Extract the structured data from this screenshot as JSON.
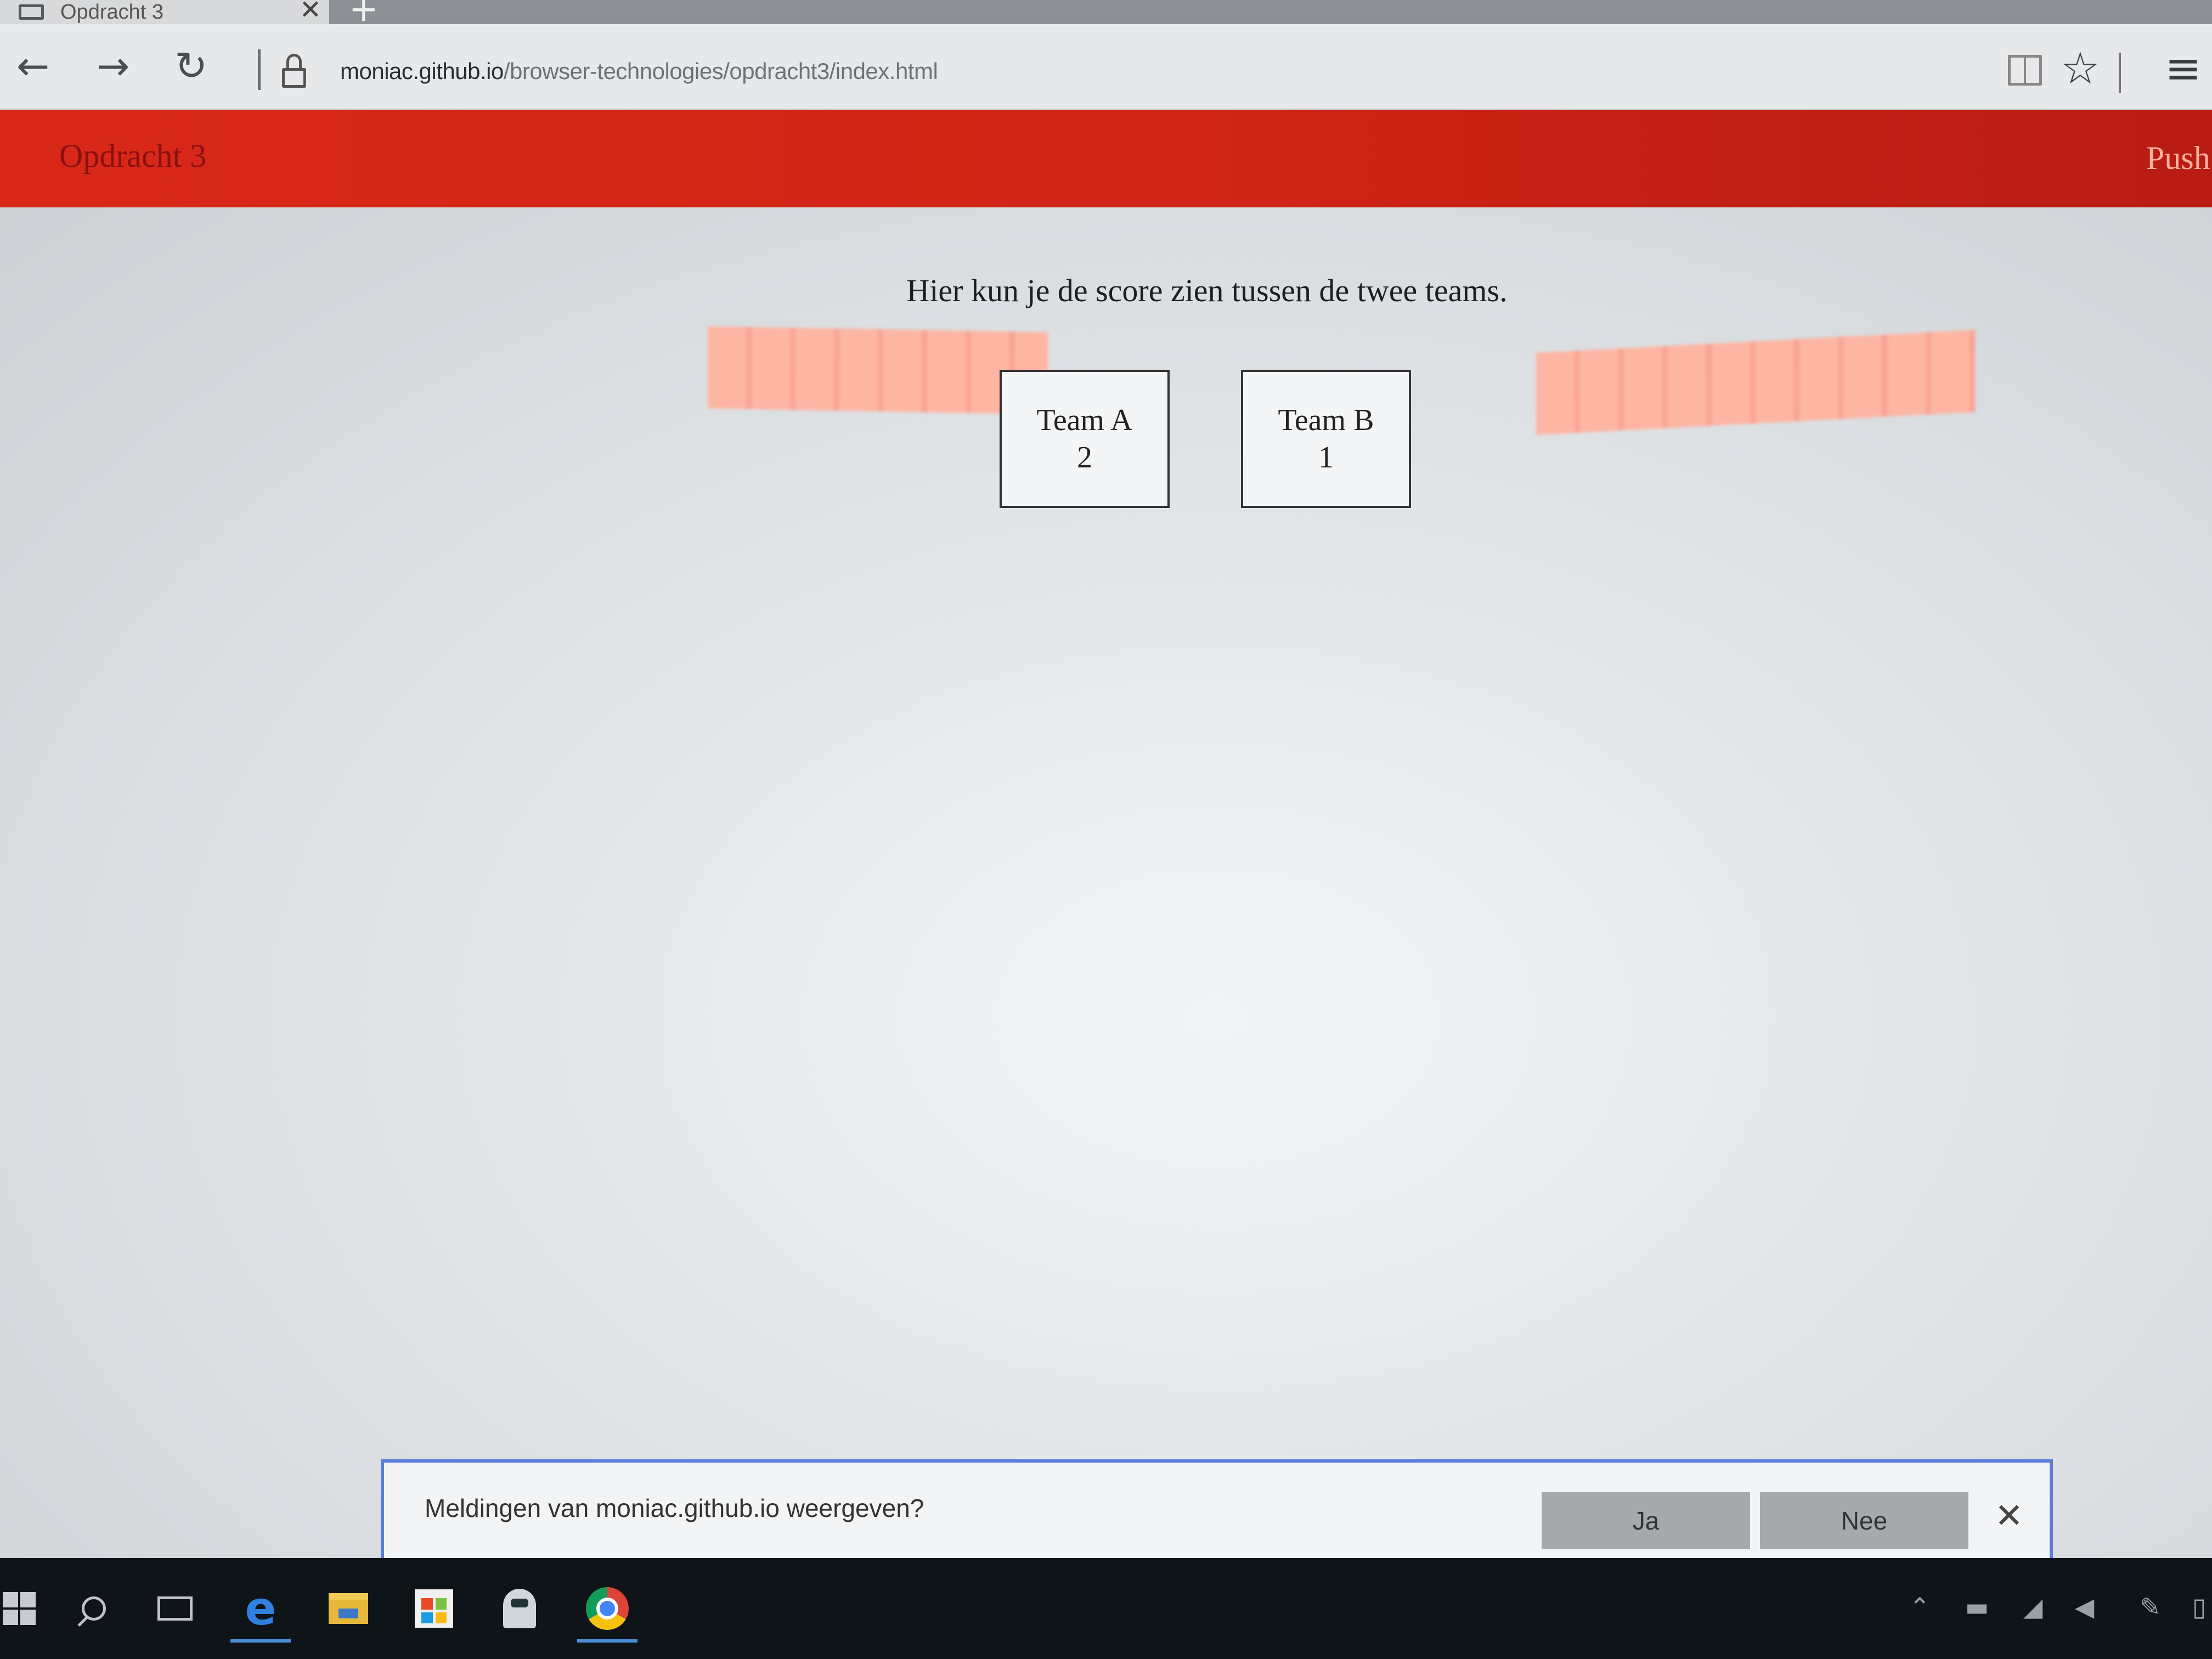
{
  "browser": {
    "tab": {
      "title": "Opdracht 3",
      "close": "✕",
      "icon": "tab-page-icon"
    },
    "new_tab": "+",
    "nav": {
      "back": "←",
      "forward": "→",
      "refresh": "↻",
      "star": "☆",
      "hub": "≡"
    },
    "address": {
      "domain": "moniac.github.io",
      "path": "/browser-technologies/opdracht3/index.html"
    }
  },
  "page": {
    "header": {
      "title": "Opdracht 3",
      "push": "Push"
    },
    "intro": "Hier kun je de score zien tussen de twee teams.",
    "teams": [
      {
        "name": "Team A",
        "score": "2"
      },
      {
        "name": "Team B",
        "score": "1"
      }
    ]
  },
  "notification": {
    "text": "Meldingen van moniac.github.io weergeven?",
    "yes_label": "Ja",
    "no_label": "Nee",
    "close": "✕"
  },
  "taskbar": {
    "apps": [
      "start-icon",
      "search-icon",
      "task-view-icon",
      "edge-icon",
      "file-explorer-icon",
      "store-icon",
      "app-icon",
      "chrome-icon"
    ],
    "edge_glyph": "e",
    "tray": {
      "up": "⌃",
      "battery": "▬",
      "wifi": "◢",
      "volume": "◀",
      "pen": "✎",
      "action": "▯"
    }
  },
  "colors": {
    "header_red": "#d82818",
    "notification_border": "#5a7fd6",
    "taskbar": "#0f1418"
  }
}
